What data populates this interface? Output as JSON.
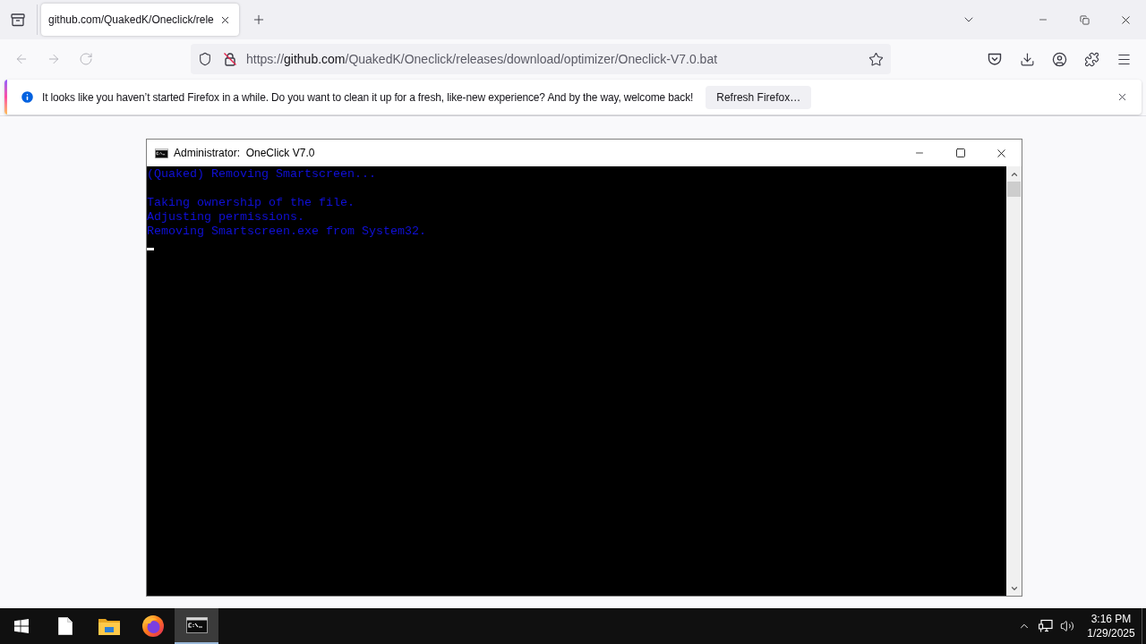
{
  "browser": {
    "tabs": [
      {
        "title": "github.com/QuakedK/Oneclick/rele",
        "selected": true
      }
    ],
    "nav_buttons": [
      {
        "kind": "back",
        "disabled": true
      },
      {
        "kind": "forward",
        "disabled": true
      },
      {
        "kind": "reload",
        "disabled": true
      }
    ],
    "url": {
      "scheme": "https://",
      "host": "github.com",
      "path": "/QuakedK/Oneclick/releases/download/optimizer/Oneclick-V7.0.bat"
    },
    "notification": {
      "message": "It looks like you haven’t started Firefox in a while. Do you want to clean it up for a fresh, like-new experience? And by the way, welcome back!",
      "button": "Refresh Firefox…"
    }
  },
  "console_window": {
    "title": "Administrator:  OneClick V7.0",
    "blocks": [
      [
        "(Quaked) Removing Smartscreen..."
      ],
      [
        "Taking ownership of the file.",
        "Adjusting permissions.",
        "Removing Smartscreen.exe from System32."
      ]
    ],
    "cursor_visible": true
  },
  "taskbar": {
    "apps": [
      {
        "kind": "file",
        "active": false
      },
      {
        "kind": "folder",
        "active": false
      },
      {
        "kind": "browser",
        "active": false
      },
      {
        "kind": "console",
        "active": true
      }
    ],
    "clock": {
      "time": "3:16 PM",
      "date": "1/29/2025"
    }
  }
}
